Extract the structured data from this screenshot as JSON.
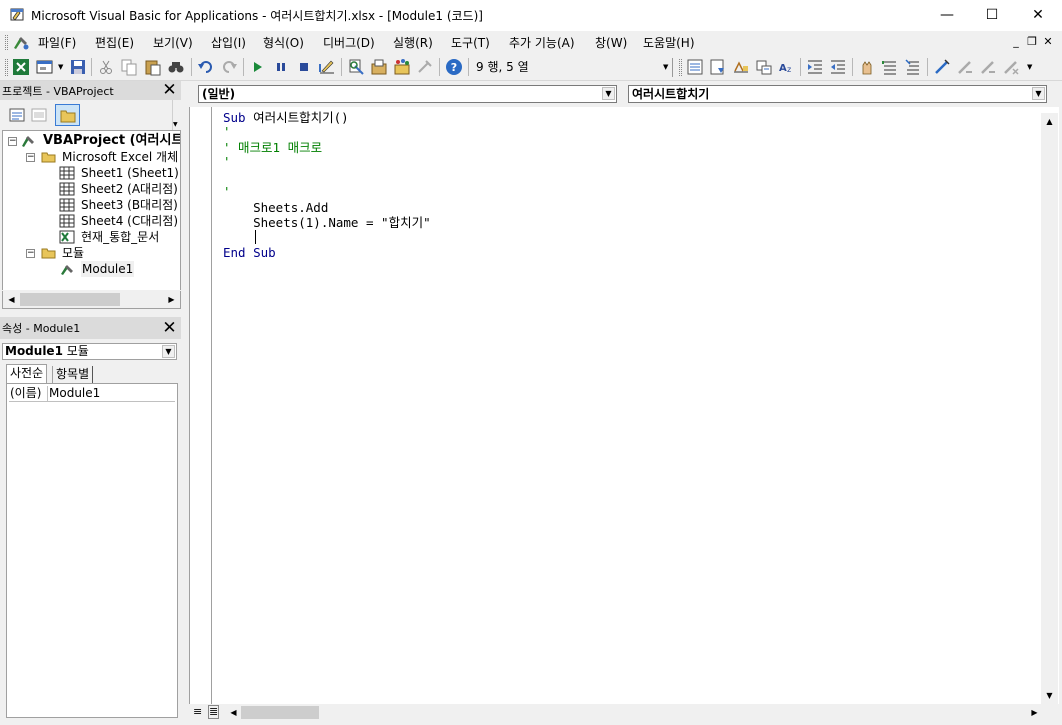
{
  "window": {
    "title": "Microsoft Visual Basic for Applications - 여러시트합치기.xlsx - [Module1 (코드)]",
    "minimize": "—",
    "maximize": "☐",
    "close": "✕"
  },
  "menu": {
    "items": [
      "파일(F)",
      "편집(E)",
      "보기(V)",
      "삽입(I)",
      "형식(O)",
      "디버그(D)",
      "실행(R)",
      "도구(T)",
      "추가 기능(A)",
      "창(W)",
      "도움말(H)"
    ]
  },
  "toolbar": {
    "position_text": "9 행, 5 열"
  },
  "project_explorer": {
    "title": "프로젝트 - VBAProject",
    "root": "VBAProject (여러시트",
    "excel_objects": "Microsoft Excel 개체",
    "sheets": [
      "Sheet1 (Sheet1)",
      "Sheet2 (A대리점)",
      "Sheet3 (B대리점)",
      "Sheet4 (C대리점)",
      "현재_통합_문서"
    ],
    "modules_folder": "모듈",
    "module": "Module1"
  },
  "properties": {
    "title": "속성 - Module1",
    "object_name": "Module1",
    "object_type": "모듈",
    "tab_alpha": "사전순",
    "tab_category": "항목별",
    "row_name": "(이름)",
    "row_value": "Module1"
  },
  "code": {
    "object_combo": "(일반)",
    "proc_combo": "여러시트합치기",
    "lines": [
      "Sub 여러시트합치기()",
      "'",
      "' 매크로1 매크로",
      "'",
      "",
      "'",
      "    Sheets.Add",
      "    Sheets(1).Name = \"합치기\"",
      "",
      "End Sub"
    ]
  },
  "colors": {
    "keyword": "#00008b",
    "comment": "#007f00",
    "panel_title": "#dbdbdb"
  }
}
